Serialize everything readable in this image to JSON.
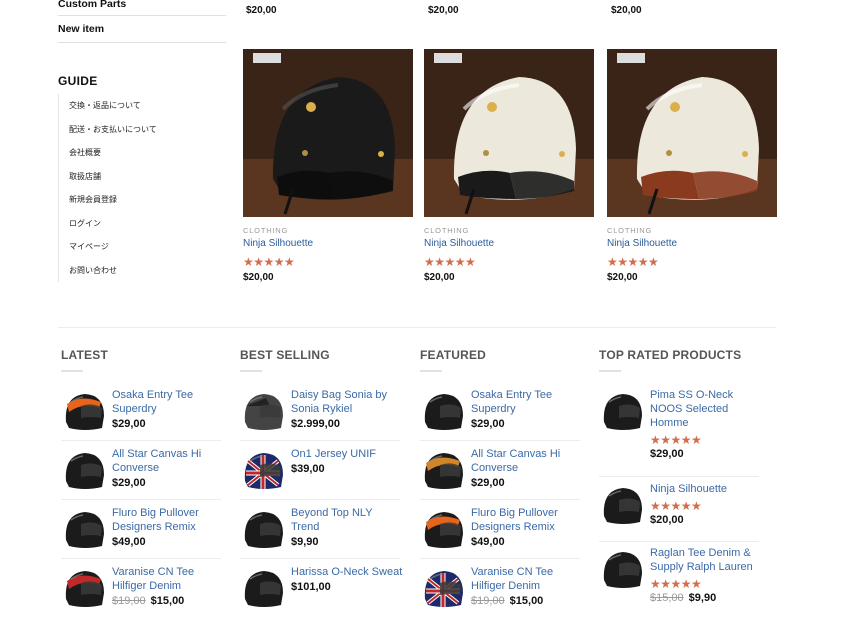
{
  "sidebar": {
    "categories": [
      "Custom Parts",
      "New item"
    ],
    "guide_title": "GUIDE",
    "guide_items": [
      "交換・返品について",
      "配送・お支払いについて",
      "会社概要",
      "取扱店舗",
      "新規会員登録",
      "ログイン",
      "マイページ",
      "お問い合わせ"
    ]
  },
  "top_prices": [
    "$20,00",
    "$20,00",
    "$20,00"
  ],
  "products": [
    {
      "category": "CLOTHING",
      "name": "Ninja Silhouette",
      "rating": "★★★★★",
      "price": "$20,00",
      "helmet_color": "#1a1a1a",
      "trim_color": "#0d0d0d"
    },
    {
      "category": "CLOTHING",
      "name": "Ninja Silhouette",
      "rating": "★★★★★",
      "price": "$20,00",
      "helmet_color": "#ece8dc",
      "trim_color": "#1a1a1a"
    },
    {
      "category": "CLOTHING",
      "name": "Ninja Silhouette",
      "rating": "★★★★★",
      "price": "$20,00",
      "helmet_color": "#ece8dc",
      "trim_color": "#8a3a1e"
    }
  ],
  "widgets": {
    "latest": {
      "title": "LATEST",
      "items": [
        {
          "name": "Osaka Entry Tee Superdry",
          "price": "$29,00",
          "old_price": "",
          "rating": ""
        },
        {
          "name": "All Star Canvas Hi Converse",
          "price": "$29,00",
          "old_price": "",
          "rating": ""
        },
        {
          "name": "Fluro Big Pullover Designers Remix",
          "price": "$49,00",
          "old_price": "",
          "rating": ""
        },
        {
          "name": "Varanise CN Tee Hilfiger Denim",
          "price": "$15,00",
          "old_price": "$19,00",
          "rating": ""
        }
      ]
    },
    "best_selling": {
      "title": "BEST SELLING",
      "items": [
        {
          "name": "Daisy Bag Sonia by Sonia Rykiel",
          "price": "$2.999,00",
          "old_price": "",
          "rating": ""
        },
        {
          "name": "On1 Jersey UNIF",
          "price": "$39,00",
          "old_price": "",
          "rating": ""
        },
        {
          "name": "Beyond Top NLY Trend",
          "price": "$9,90",
          "old_price": "",
          "rating": ""
        },
        {
          "name": "Harissa O-Neck Sweat",
          "price": "$101,00",
          "old_price": "",
          "rating": ""
        }
      ]
    },
    "featured": {
      "title": "FEATURED",
      "items": [
        {
          "name": "Osaka Entry Tee Superdry",
          "price": "$29,00",
          "old_price": "",
          "rating": ""
        },
        {
          "name": "All Star Canvas Hi Converse",
          "price": "$29,00",
          "old_price": "",
          "rating": ""
        },
        {
          "name": "Fluro Big Pullover Designers Remix",
          "price": "$49,00",
          "old_price": "",
          "rating": ""
        },
        {
          "name": "Varanise CN Tee Hilfiger Denim",
          "price": "$15,00",
          "old_price": "$19,00",
          "rating": ""
        }
      ]
    },
    "top_rated": {
      "title": "TOP RATED PRODUCTS",
      "items": [
        {
          "name": "Pima SS O-Neck NOOS Selected Homme",
          "price": "$29,00",
          "old_price": "",
          "rating": "★★★★★"
        },
        {
          "name": "Ninja Silhouette",
          "price": "$20,00",
          "old_price": "",
          "rating": "★★★★★"
        },
        {
          "name": "Raglan Tee Denim & Supply Ralph Lauren",
          "price": "$9,90",
          "old_price": "$15,00",
          "rating": "★★★★★"
        }
      ]
    }
  },
  "colors": {
    "accent_star": "#d26e4b",
    "link": "#3b6aa6"
  }
}
